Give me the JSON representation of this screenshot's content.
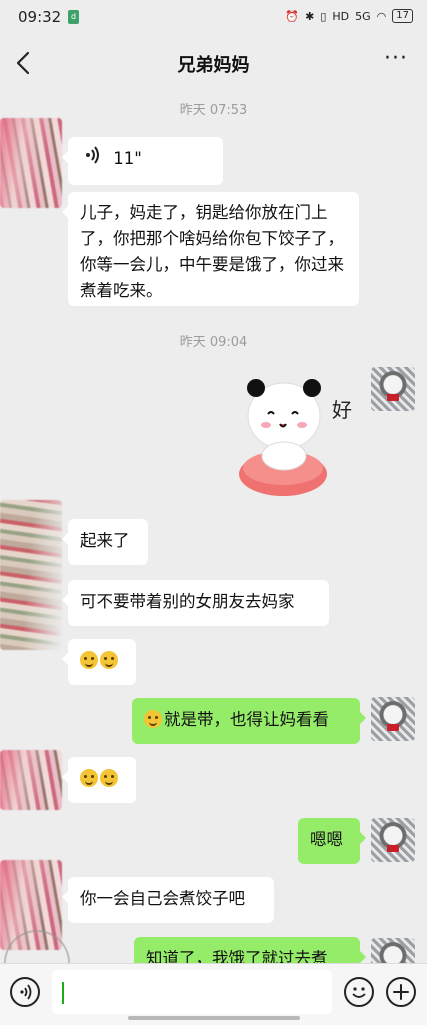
{
  "status_bar": {
    "time": "09:32",
    "network": "5G",
    "battery": "17"
  },
  "header": {
    "title": "兄弟妈妈",
    "more_label": "···"
  },
  "timestamps": [
    "昨天 07:53",
    "昨天 09:04"
  ],
  "messages": {
    "voice_duration": "11\"",
    "m1": "儿子，妈走了，钥匙给你放在门上了，你把那个啥妈给你包下饺子了，你等一会儿，中午要是饿了，你过来煮着吃来。",
    "sticker_text": "好",
    "m2": "起来了",
    "m3": "可不要带着别的女朋友去妈家",
    "m5": "就是带，也得让妈看看",
    "m7": "嗯嗯",
    "m8": "你一会自己会煮饺子吧",
    "m9": "知道了，我饿了就过去煮"
  },
  "input": {
    "value": "",
    "placeholder": ""
  },
  "icons": {
    "back": "chevron-left-icon",
    "more": "more-dots-icon",
    "voice": "voice-icon",
    "emoji": "emoji-icon",
    "plus": "plus-icon"
  },
  "colors": {
    "background": "#ededed",
    "outgoing_bubble": "#95ec69",
    "incoming_bubble": "#ffffff"
  }
}
